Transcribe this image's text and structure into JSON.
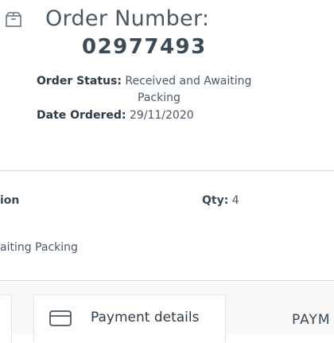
{
  "order": {
    "heading": "Order Number:",
    "number": "02977493",
    "status_label": "Order Status:",
    "status_value_line1": "Received and Awaiting",
    "status_value_line2": "Packing",
    "date_label": "Date Ordered:",
    "date_value": "29/11/2020"
  },
  "item": {
    "title_fragment": "ion",
    "qty_label": "Qty:",
    "qty_value": "4",
    "status_fragment": "aiting Packing"
  },
  "tabs": {
    "payment_details": "Payment details",
    "payment_fragment": "PAYM"
  },
  "icons": {
    "header": "package-box-icon",
    "payment": "credit-card-icon"
  }
}
